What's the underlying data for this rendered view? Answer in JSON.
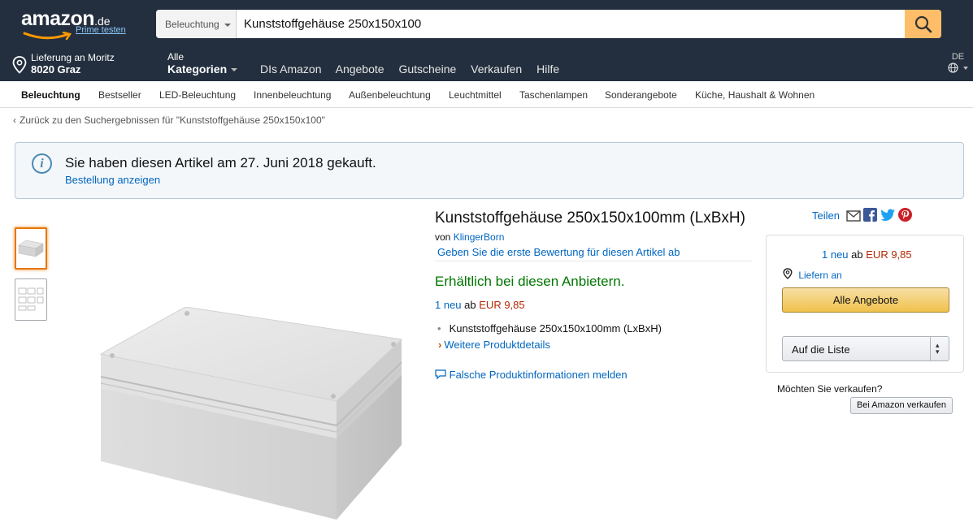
{
  "header": {
    "logo_text": "amazon",
    "logo_tld": ".de",
    "prime_link": "Prime testen",
    "search": {
      "category": "Beleuchtung",
      "query": "Kunststoffgehäuse 250x150x100"
    },
    "deliver": {
      "line1": "Lieferung an Moritz",
      "line2": "8020 Graz"
    },
    "all_categories": {
      "line1": "Alle",
      "line2": "Kategorien"
    },
    "nav_links": [
      "DIs Amazon",
      "Angebote",
      "Gutscheine",
      "Verkaufen",
      "Hilfe"
    ],
    "language": "DE"
  },
  "subnav": {
    "items": [
      "Beleuchtung",
      "Bestseller",
      "LED-Beleuchtung",
      "Innenbeleuchtung",
      "Außenbeleuchtung",
      "Leuchtmittel",
      "Taschenlampen",
      "Sonderangebote",
      "Küche, Haushalt & Wohnen"
    ]
  },
  "breadcrumb": {
    "text": "Zurück zu den Suchergebnissen für \"Kunststoffgehäuse 250x150x100\""
  },
  "notice": {
    "title": "Sie haben diesen Artikel am 27. Juni 2018 gekauft.",
    "link": "Bestellung anzeigen"
  },
  "product": {
    "title": "Kunststoffgehäuse 250x150x100mm (LxBxH)",
    "by_prefix": "von",
    "brand": "KlingerBorn",
    "review_link": "Geben Sie die erste Bewertung für diesen Artikel ab",
    "availability_prefix": "Erhältlich bei",
    "availability_link": "diesen Anbietern.",
    "offers_count": "1 neu",
    "offers_from": "ab",
    "price": "EUR 9,85",
    "bullets": [
      "Kunststoffgehäuse 250x150x100mm (LxBxH)"
    ],
    "more_details": "Weitere Produktdetails",
    "report_link": "Falsche Produktinformationen melden"
  },
  "buybox": {
    "share_label": "Teilen",
    "offers_count": "1 neu",
    "offers_from": "ab",
    "price": "EUR 9,85",
    "deliver_label": "Liefern an",
    "all_offers_button": "Alle Angebote",
    "list_button": "Auf die Liste",
    "sell_question": "Möchten Sie verkaufen?",
    "sell_button": "Bei Amazon verkaufen"
  },
  "colors": {
    "nav_bg": "#232f3e",
    "link": "#0066c0",
    "price": "#b12704",
    "availability": "#007600",
    "search_button": "#febd69"
  }
}
